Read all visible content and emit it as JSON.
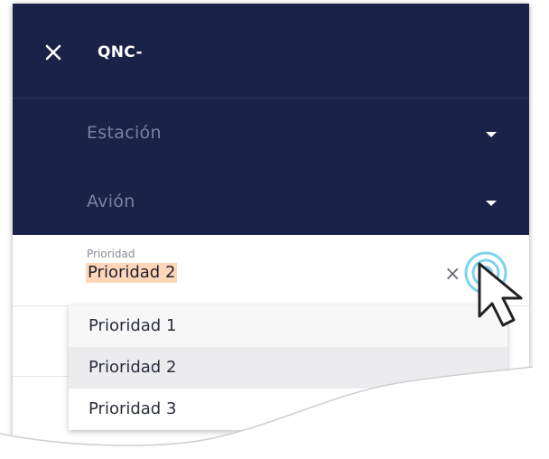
{
  "header": {
    "title": "QNC-",
    "close_icon": "close-icon"
  },
  "fields": {
    "estacion": {
      "label": "Estación"
    },
    "avion": {
      "label": "Avión"
    }
  },
  "priority": {
    "label": "Prioridad",
    "value": "Prioridad 2",
    "clear_glyph": "×"
  },
  "options": [
    "Prioridad 1",
    "Prioridad 2",
    "Prioridad 3"
  ],
  "colors": {
    "header_bg": "#1b2248",
    "highlight": "#ffd6b8",
    "ripple": "#7fd3ec"
  }
}
